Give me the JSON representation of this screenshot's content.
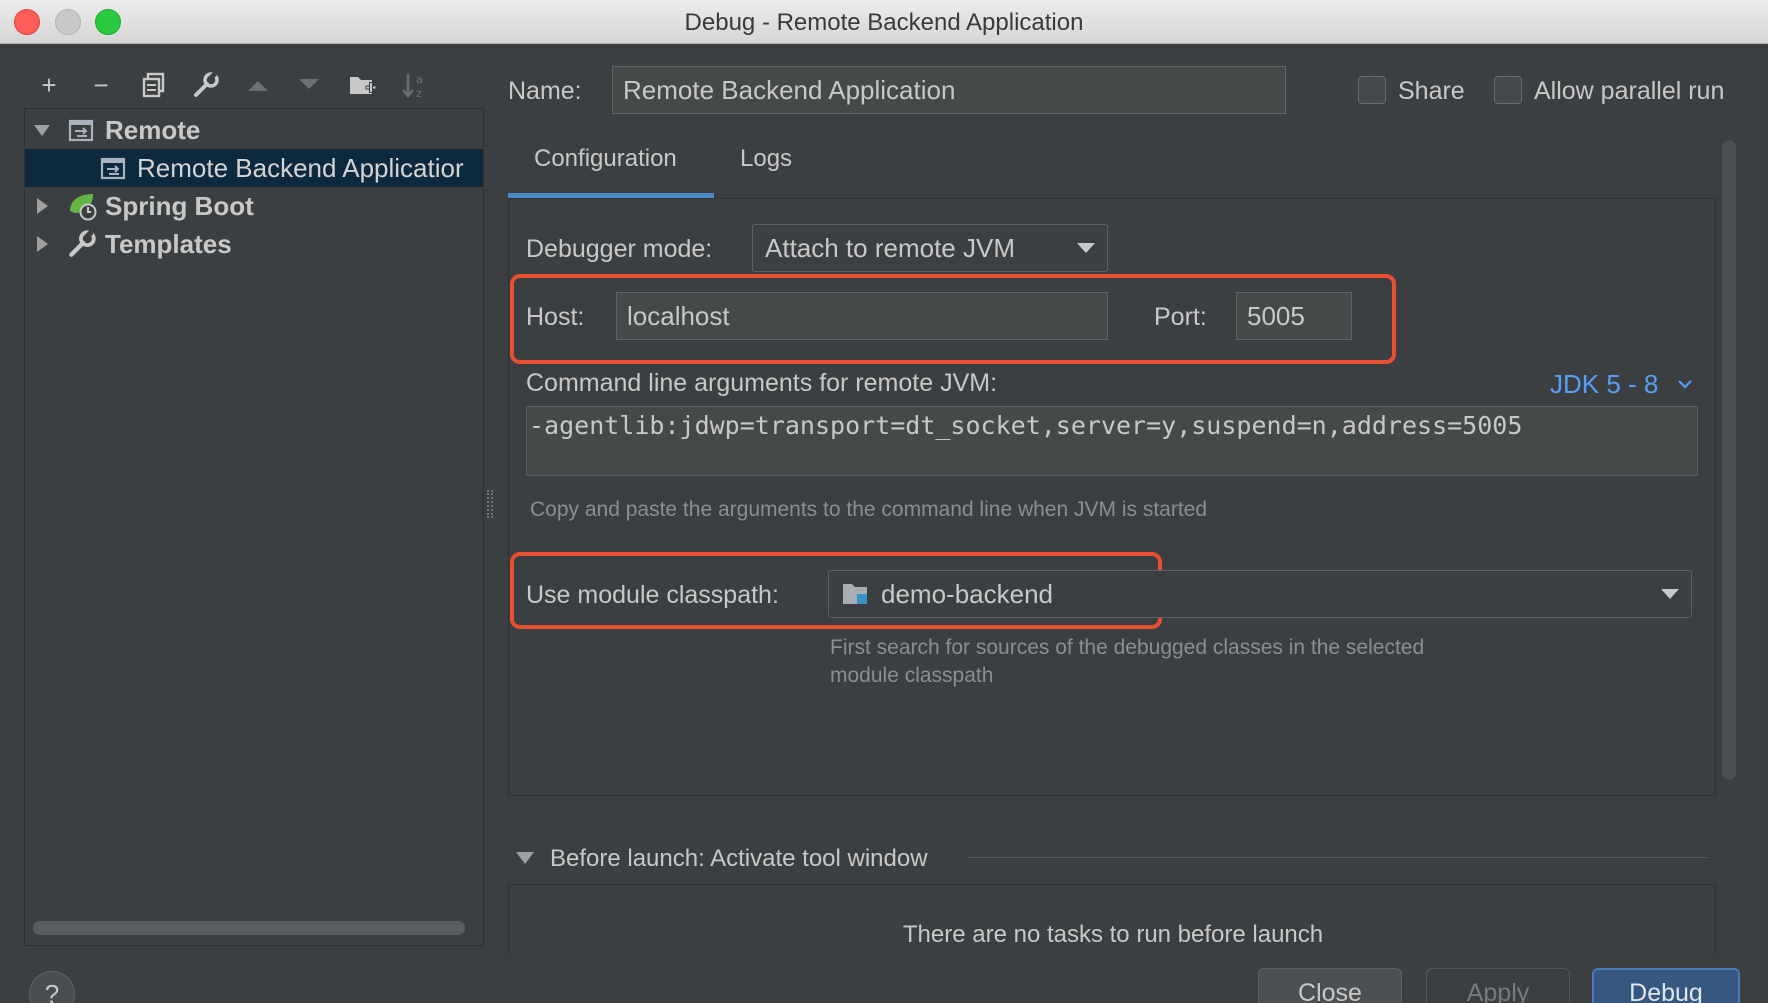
{
  "window": {
    "title": "Debug - Remote Backend Application"
  },
  "toolbar": {
    "icons": [
      "add-icon",
      "remove-icon",
      "copy-icon",
      "wrench-icon",
      "move-up-icon",
      "move-down-icon",
      "new-folder-icon",
      "sort-icon"
    ]
  },
  "tree": {
    "items": [
      {
        "label": "Remote",
        "expanded": true,
        "level": 0,
        "icon": "remote-icon"
      },
      {
        "label": "Remote Backend Applicatior",
        "level": 1,
        "selected": true,
        "icon": "remote-config-icon"
      },
      {
        "label": "Spring Boot",
        "expanded": false,
        "level": 0,
        "icon": "spring-boot-icon"
      },
      {
        "label": "Templates",
        "expanded": false,
        "level": 0,
        "icon": "wrench-icon"
      }
    ]
  },
  "form": {
    "name_label": "Name:",
    "name_value": "Remote Backend Application",
    "share_label": "Share",
    "allow_parallel_label": "Allow parallel run",
    "tabs": [
      "Configuration",
      "Logs"
    ],
    "active_tab": "Configuration",
    "debugger_mode_label": "Debugger mode:",
    "debugger_mode_value": "Attach to remote JVM",
    "host_label": "Host:",
    "host_value": "localhost",
    "port_label": "Port:",
    "port_value": "5005",
    "cmd_label": "Command line arguments for remote JVM:",
    "jdk_link": "JDK 5 - 8",
    "cmd_value": "-agentlib:jdwp=transport=dt_socket,server=y,suspend=n,address=5005",
    "cmd_hint": "Copy and paste the arguments to the command line when JVM is started",
    "module_label": "Use module classpath:",
    "module_value": "demo-backend",
    "module_hint_1": "First search for sources of the debugged classes in the selected",
    "module_hint_2": "module classpath",
    "before_launch_label": "Before launch: Activate tool window",
    "no_tasks": "There are no tasks to run before launch"
  },
  "buttons": {
    "help": "?",
    "close": "Close",
    "apply": "Apply",
    "debug": "Debug"
  },
  "colors": {
    "highlight": "#e8502f",
    "accent": "#4a88c7",
    "link": "#589df6",
    "selection": "#0d293e"
  }
}
